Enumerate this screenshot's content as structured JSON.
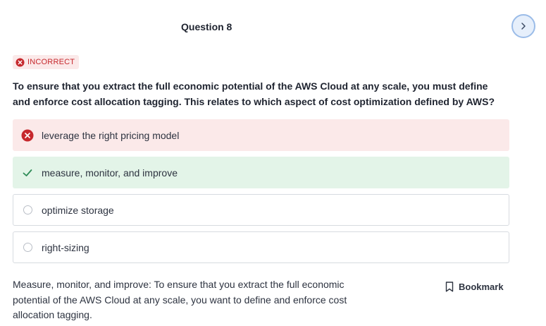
{
  "header": {
    "question_title": "Question 8",
    "next_icon": "chevron-right-icon"
  },
  "status": {
    "label": "INCORRECT",
    "icon": "x-circle-icon",
    "color": "#c6282d"
  },
  "question": {
    "text": "To ensure that you extract the full economic potential of the AWS Cloud at any scale, you must define and enforce cost allocation tagging. This relates to which aspect of cost optimization defined by AWS?"
  },
  "options": [
    {
      "label": "leverage the right pricing model",
      "state": "incorrect-selected",
      "icon": "x-circle-icon"
    },
    {
      "label": "measure, monitor, and improve",
      "state": "correct",
      "icon": "check-icon"
    },
    {
      "label": "optimize storage",
      "state": "unselected",
      "icon": "radio-icon"
    },
    {
      "label": "right-sizing",
      "state": "unselected",
      "icon": "radio-icon"
    }
  ],
  "explanation": {
    "text": "Measure, monitor, and improve: To ensure that you extract the full economic potential of the AWS Cloud at any scale, you want to define and enforce cost allocation tagging."
  },
  "bookmark": {
    "label": "Bookmark",
    "icon": "bookmark-icon"
  },
  "colors": {
    "incorrect_bg": "#fbe9e9",
    "correct_bg": "#e3f4e8",
    "incorrect_icon": "#c6282d",
    "correct_icon": "#2e8b57",
    "accent": "#4a7fd4"
  }
}
